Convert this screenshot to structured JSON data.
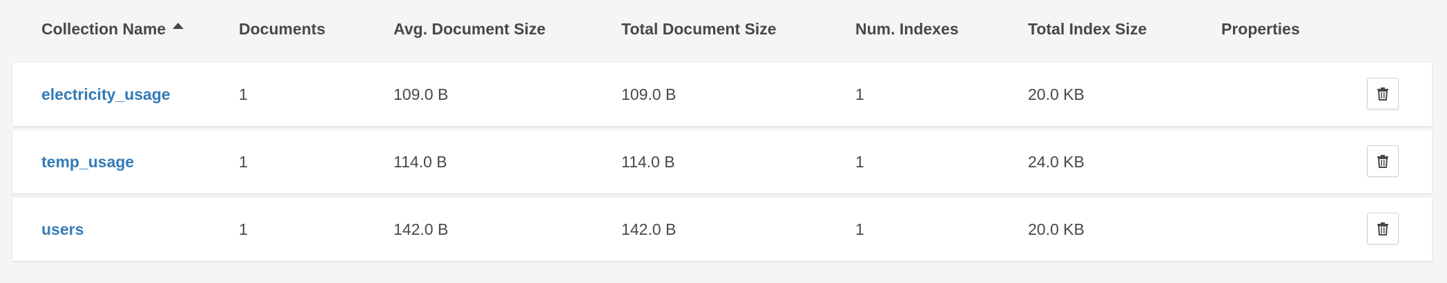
{
  "headers": {
    "collection_name": "Collection Name",
    "documents": "Documents",
    "avg_document_size": "Avg. Document Size",
    "total_document_size": "Total Document Size",
    "num_indexes": "Num. Indexes",
    "total_index_size": "Total Index Size",
    "properties": "Properties",
    "sort_icon": "sort-ascending-icon"
  },
  "rows": [
    {
      "name": "electricity_usage",
      "documents": "1",
      "avg_document_size": "109.0 B",
      "total_document_size": "109.0 B",
      "num_indexes": "1",
      "total_index_size": "20.0 KB",
      "properties": "",
      "delete_icon": "trash-icon"
    },
    {
      "name": "temp_usage",
      "documents": "1",
      "avg_document_size": "114.0 B",
      "total_document_size": "114.0 B",
      "num_indexes": "1",
      "total_index_size": "24.0 KB",
      "properties": "",
      "delete_icon": "trash-icon"
    },
    {
      "name": "users",
      "documents": "1",
      "avg_document_size": "142.0 B",
      "total_document_size": "142.0 B",
      "num_indexes": "1",
      "total_index_size": "20.0 KB",
      "properties": "",
      "delete_icon": "trash-icon"
    }
  ],
  "colors": {
    "background": "#f4f5f6",
    "row_background": "#ffffff",
    "link": "#337ab7",
    "text": "#494747"
  }
}
